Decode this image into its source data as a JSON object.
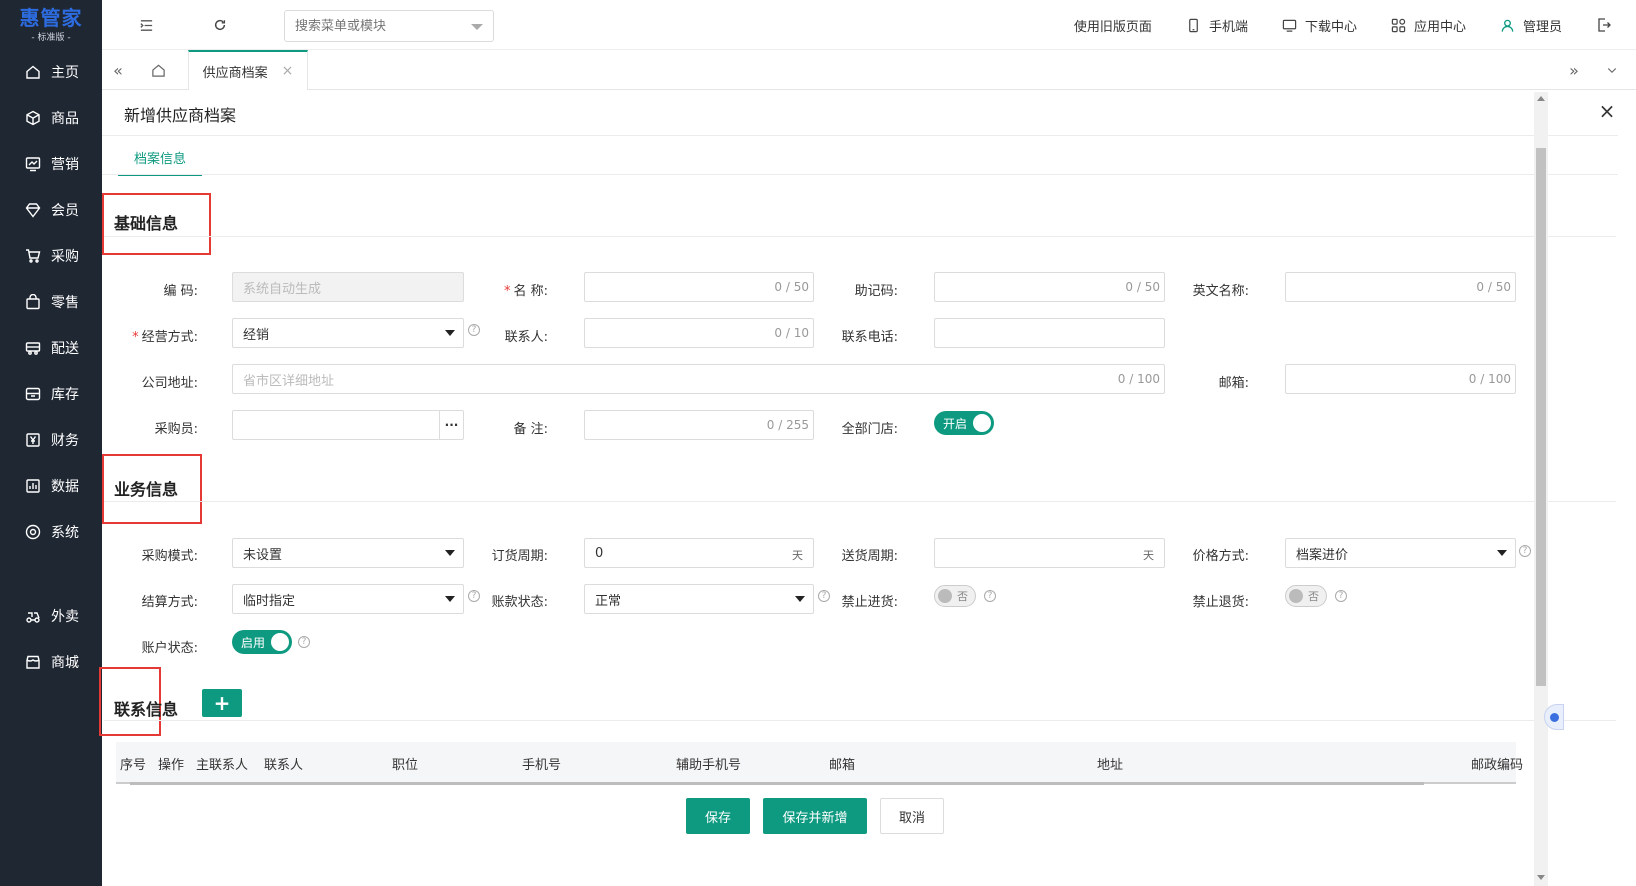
{
  "app": {
    "logo": "惠管家",
    "edition": "- 标准版 -"
  },
  "sidebar": {
    "items": [
      {
        "label": "主页",
        "icon": "home-icon"
      },
      {
        "label": "商品",
        "icon": "box-icon"
      },
      {
        "label": "营销",
        "icon": "chart-icon"
      },
      {
        "label": "会员",
        "icon": "diamond-icon"
      },
      {
        "label": "采购",
        "icon": "cart-icon"
      },
      {
        "label": "零售",
        "icon": "bag-icon"
      },
      {
        "label": "配送",
        "icon": "truck-icon"
      },
      {
        "label": "库存",
        "icon": "warehouse-icon"
      },
      {
        "label": "财务",
        "icon": "yen-icon"
      },
      {
        "label": "数据",
        "icon": "bar-chart-icon"
      },
      {
        "label": "系统",
        "icon": "settings-icon"
      },
      {
        "label": "外卖",
        "icon": "delivery-icon"
      },
      {
        "label": "商城",
        "icon": "store-icon"
      }
    ]
  },
  "topbar": {
    "search_placeholder": "搜索菜单或模块",
    "links": {
      "old_version": "使用旧版页面",
      "mobile": "手机端",
      "download": "下载中心",
      "apps": "应用中心",
      "user": "管理员"
    }
  },
  "tabs": {
    "active": "供应商档案"
  },
  "panel": {
    "title": "新增供应商档案",
    "subtab": "档案信息"
  },
  "basic": {
    "title": "基础信息",
    "code_label": "编 码:",
    "code_placeholder": "系统自动生成",
    "name_label": "名 称:",
    "name_count": "0 / 50",
    "mnemonic_label": "助记码:",
    "mnemonic_count": "0 / 50",
    "english_label": "英文名称:",
    "english_count": "0 / 50",
    "mode_label": "经营方式:",
    "mode_value": "经销",
    "contact_label": "联系人:",
    "contact_count": "0 / 10",
    "phone_label": "联系电话:",
    "address_label": "公司地址:",
    "address_placeholder": "省市区详细地址",
    "address_count": "0 / 100",
    "email_label": "邮箱:",
    "email_count": "0 / 100",
    "buyer_label": "采购员:",
    "buyer_more": "···",
    "remark_label": "备 注:",
    "remark_count": "0 / 255",
    "all_stores_label": "全部门店:",
    "all_stores_toggle": "开启"
  },
  "business": {
    "title": "业务信息",
    "purchase_mode_label": "采购模式:",
    "purchase_mode_value": "未设置",
    "order_cycle_label": "订货周期:",
    "order_cycle_value": "0",
    "order_cycle_unit": "天",
    "delivery_cycle_label": "送货周期:",
    "delivery_cycle_unit": "天",
    "price_mode_label": "价格方式:",
    "price_mode_value": "档案进价",
    "settle_label": "结算方式:",
    "settle_value": "临时指定",
    "account_status_label": "账款状态:",
    "account_status_value": "正常",
    "ban_in_label": "禁止进货:",
    "ban_in_toggle": "否",
    "ban_return_label": "禁止退货:",
    "ban_return_toggle": "否",
    "acct_label": "账户状态:",
    "acct_toggle": "启用"
  },
  "contacts": {
    "title": "联系信息",
    "add_label": "+",
    "columns": [
      "序号",
      "操作",
      "主联系人",
      "联系人",
      "职位",
      "手机号",
      "辅助手机号",
      "邮箱",
      "地址",
      "邮政编码"
    ]
  },
  "footer": {
    "save": "保存",
    "save_new": "保存并新增",
    "cancel": "取消"
  },
  "colors": {
    "sidebar_bg": "#1f2733",
    "accent": "#0e9a80",
    "highlight_box": "#e53935"
  }
}
